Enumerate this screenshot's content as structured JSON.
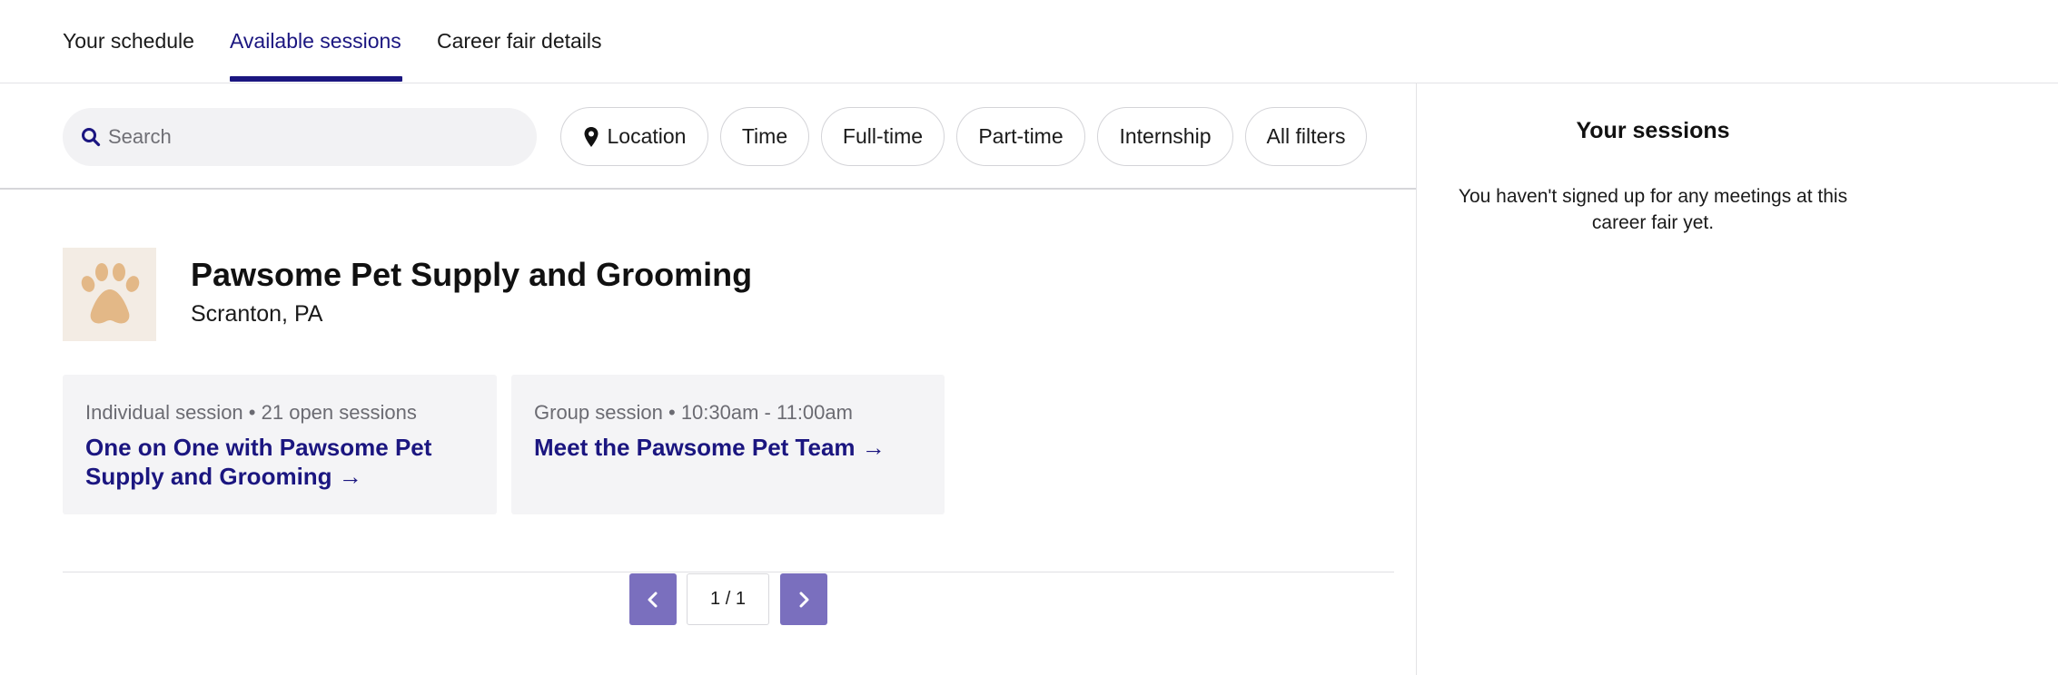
{
  "nav": {
    "tabs": [
      {
        "label": "Your schedule",
        "active": false
      },
      {
        "label": "Available sessions",
        "active": true
      },
      {
        "label": "Career fair details",
        "active": false
      }
    ]
  },
  "filters": {
    "search_placeholder": "Search",
    "chips": [
      "Location",
      "Time",
      "Full-time",
      "Part-time",
      "Internship",
      "All filters"
    ]
  },
  "employer": {
    "name": "Pawsome Pet Supply and Grooming",
    "location": "Scranton, PA",
    "logo_icon": "paw-icon",
    "sessions": [
      {
        "type": "Individual session",
        "detail": "21 open sessions",
        "title": "One on One with Pawsome Pet Supply and Grooming →"
      },
      {
        "type": "Group session",
        "detail": "10:30am - 11:00am",
        "title": "Meet the Pawsome Pet Team →"
      }
    ]
  },
  "pagination": {
    "label": "1 / 1"
  },
  "sidebar": {
    "title": "Your sessions",
    "empty_text": "You haven't signed up for any meetings at this career fair yet."
  },
  "colors": {
    "accent": "#1b1680",
    "pager_button": "#7a6fbe",
    "card_bg": "#f4f4f6",
    "logo_bg": "#f3ece4",
    "paw": "#e3b887"
  }
}
